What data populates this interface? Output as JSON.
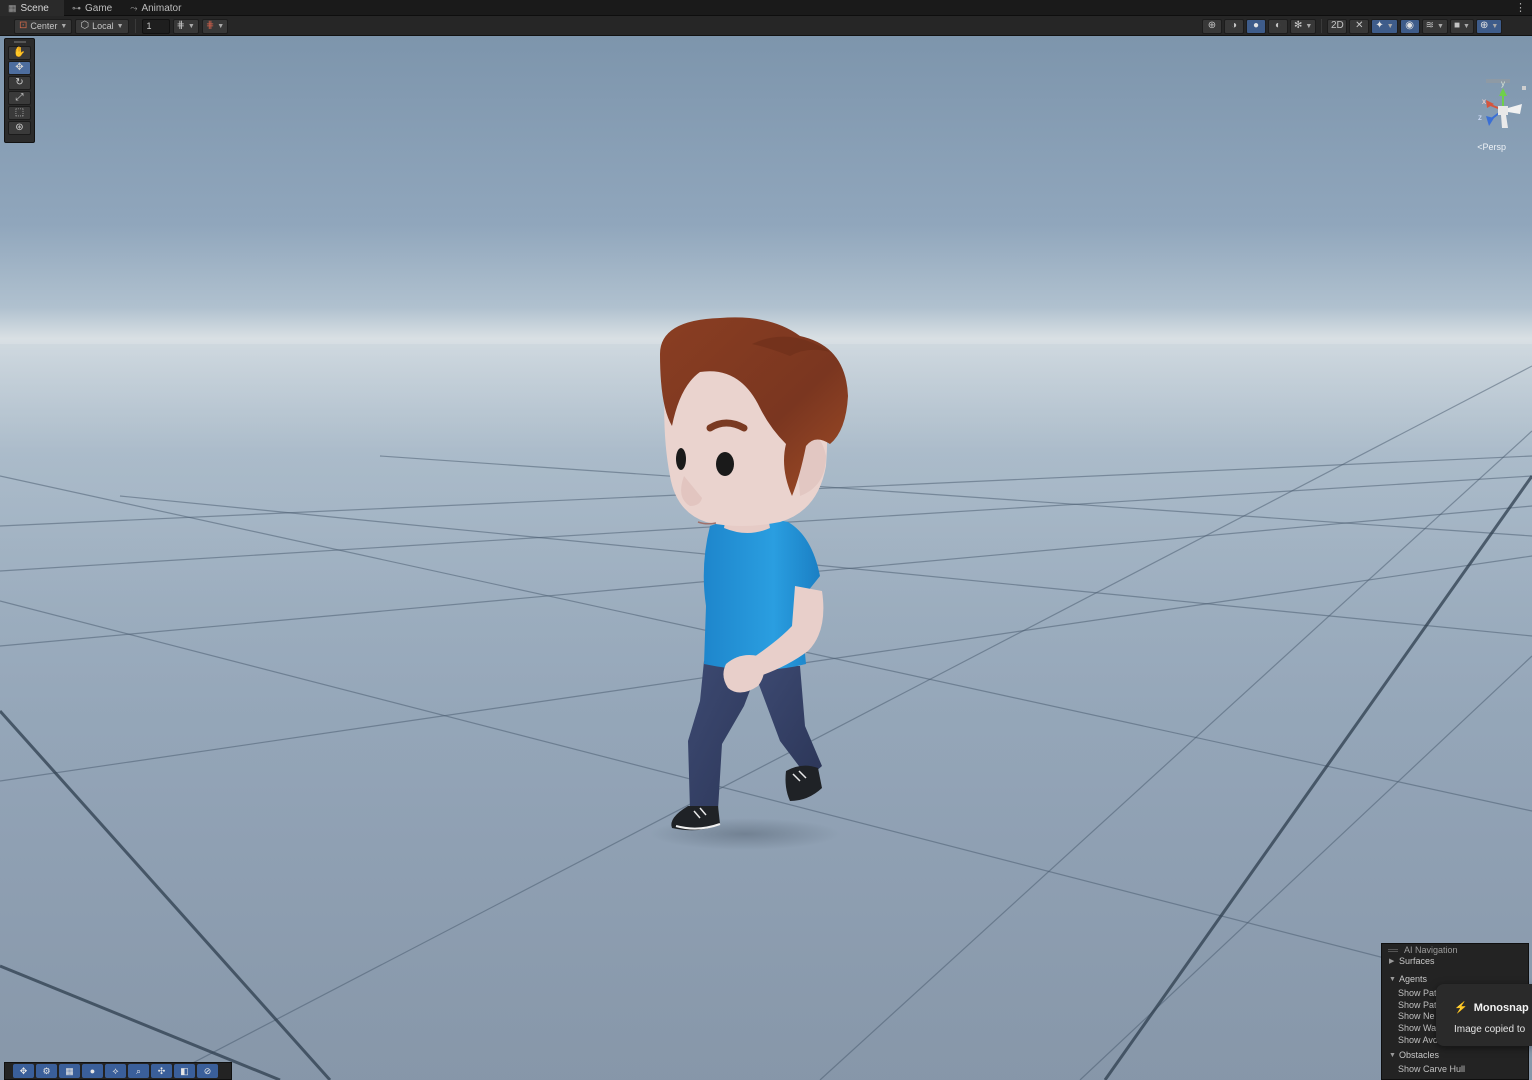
{
  "tabs": [
    {
      "label": "Scene",
      "icon": "grid-icon"
    },
    {
      "label": "Game",
      "icon": "gamepad-icon"
    },
    {
      "label": "Animator",
      "icon": "animator-icon"
    }
  ],
  "toolbar": {
    "pivot_mode": "Center",
    "pivot_rotation": "Local",
    "grid_increment": "1"
  },
  "scene_tools": [
    "hand-tool",
    "move-tool",
    "rotate-tool",
    "scale-tool",
    "rect-tool",
    "transform-tool"
  ],
  "gizmo": {
    "y_label": "y",
    "x_label": "x",
    "z_label": "z",
    "projection": "Persp"
  },
  "ai_navigation": {
    "title": "AI Navigation",
    "sections": {
      "surfaces": "Surfaces",
      "agents": "Agents",
      "obstacles": "Obstacles"
    },
    "agent_options": [
      "Show Pat",
      "Show Pat",
      "Show Ne",
      "Show Wa",
      "Show Avo"
    ],
    "obstacle_option": "Show Carve Hull"
  },
  "toast": {
    "app": "Monosnap",
    "message": "Image copied to"
  },
  "colors": {
    "active_blue": "#3e5c8a",
    "toolbar_bg": "#262626",
    "sky_top": "#7d95ac",
    "horizon": "#d9e0e4",
    "ground": "#8fa0b3"
  }
}
